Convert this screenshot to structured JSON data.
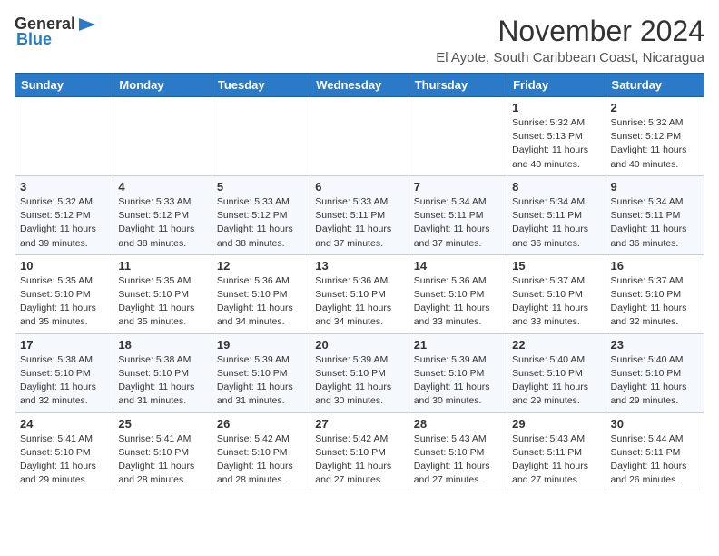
{
  "header": {
    "logo_line1": "General",
    "logo_line2": "Blue",
    "month": "November 2024",
    "location": "El Ayote, South Caribbean Coast, Nicaragua"
  },
  "days_of_week": [
    "Sunday",
    "Monday",
    "Tuesday",
    "Wednesday",
    "Thursday",
    "Friday",
    "Saturday"
  ],
  "weeks": [
    {
      "days": [
        {
          "date": "",
          "info": ""
        },
        {
          "date": "",
          "info": ""
        },
        {
          "date": "",
          "info": ""
        },
        {
          "date": "",
          "info": ""
        },
        {
          "date": "",
          "info": ""
        },
        {
          "date": "1",
          "info": "Sunrise: 5:32 AM\nSunset: 5:13 PM\nDaylight: 11 hours\nand 40 minutes."
        },
        {
          "date": "2",
          "info": "Sunrise: 5:32 AM\nSunset: 5:12 PM\nDaylight: 11 hours\nand 40 minutes."
        }
      ]
    },
    {
      "days": [
        {
          "date": "3",
          "info": "Sunrise: 5:32 AM\nSunset: 5:12 PM\nDaylight: 11 hours\nand 39 minutes."
        },
        {
          "date": "4",
          "info": "Sunrise: 5:33 AM\nSunset: 5:12 PM\nDaylight: 11 hours\nand 38 minutes."
        },
        {
          "date": "5",
          "info": "Sunrise: 5:33 AM\nSunset: 5:12 PM\nDaylight: 11 hours\nand 38 minutes."
        },
        {
          "date": "6",
          "info": "Sunrise: 5:33 AM\nSunset: 5:11 PM\nDaylight: 11 hours\nand 37 minutes."
        },
        {
          "date": "7",
          "info": "Sunrise: 5:34 AM\nSunset: 5:11 PM\nDaylight: 11 hours\nand 37 minutes."
        },
        {
          "date": "8",
          "info": "Sunrise: 5:34 AM\nSunset: 5:11 PM\nDaylight: 11 hours\nand 36 minutes."
        },
        {
          "date": "9",
          "info": "Sunrise: 5:34 AM\nSunset: 5:11 PM\nDaylight: 11 hours\nand 36 minutes."
        }
      ]
    },
    {
      "days": [
        {
          "date": "10",
          "info": "Sunrise: 5:35 AM\nSunset: 5:10 PM\nDaylight: 11 hours\nand 35 minutes."
        },
        {
          "date": "11",
          "info": "Sunrise: 5:35 AM\nSunset: 5:10 PM\nDaylight: 11 hours\nand 35 minutes."
        },
        {
          "date": "12",
          "info": "Sunrise: 5:36 AM\nSunset: 5:10 PM\nDaylight: 11 hours\nand 34 minutes."
        },
        {
          "date": "13",
          "info": "Sunrise: 5:36 AM\nSunset: 5:10 PM\nDaylight: 11 hours\nand 34 minutes."
        },
        {
          "date": "14",
          "info": "Sunrise: 5:36 AM\nSunset: 5:10 PM\nDaylight: 11 hours\nand 33 minutes."
        },
        {
          "date": "15",
          "info": "Sunrise: 5:37 AM\nSunset: 5:10 PM\nDaylight: 11 hours\nand 33 minutes."
        },
        {
          "date": "16",
          "info": "Sunrise: 5:37 AM\nSunset: 5:10 PM\nDaylight: 11 hours\nand 32 minutes."
        }
      ]
    },
    {
      "days": [
        {
          "date": "17",
          "info": "Sunrise: 5:38 AM\nSunset: 5:10 PM\nDaylight: 11 hours\nand 32 minutes."
        },
        {
          "date": "18",
          "info": "Sunrise: 5:38 AM\nSunset: 5:10 PM\nDaylight: 11 hours\nand 31 minutes."
        },
        {
          "date": "19",
          "info": "Sunrise: 5:39 AM\nSunset: 5:10 PM\nDaylight: 11 hours\nand 31 minutes."
        },
        {
          "date": "20",
          "info": "Sunrise: 5:39 AM\nSunset: 5:10 PM\nDaylight: 11 hours\nand 30 minutes."
        },
        {
          "date": "21",
          "info": "Sunrise: 5:39 AM\nSunset: 5:10 PM\nDaylight: 11 hours\nand 30 minutes."
        },
        {
          "date": "22",
          "info": "Sunrise: 5:40 AM\nSunset: 5:10 PM\nDaylight: 11 hours\nand 29 minutes."
        },
        {
          "date": "23",
          "info": "Sunrise: 5:40 AM\nSunset: 5:10 PM\nDaylight: 11 hours\nand 29 minutes."
        }
      ]
    },
    {
      "days": [
        {
          "date": "24",
          "info": "Sunrise: 5:41 AM\nSunset: 5:10 PM\nDaylight: 11 hours\nand 29 minutes."
        },
        {
          "date": "25",
          "info": "Sunrise: 5:41 AM\nSunset: 5:10 PM\nDaylight: 11 hours\nand 28 minutes."
        },
        {
          "date": "26",
          "info": "Sunrise: 5:42 AM\nSunset: 5:10 PM\nDaylight: 11 hours\nand 28 minutes."
        },
        {
          "date": "27",
          "info": "Sunrise: 5:42 AM\nSunset: 5:10 PM\nDaylight: 11 hours\nand 27 minutes."
        },
        {
          "date": "28",
          "info": "Sunrise: 5:43 AM\nSunset: 5:10 PM\nDaylight: 11 hours\nand 27 minutes."
        },
        {
          "date": "29",
          "info": "Sunrise: 5:43 AM\nSunset: 5:11 PM\nDaylight: 11 hours\nand 27 minutes."
        },
        {
          "date": "30",
          "info": "Sunrise: 5:44 AM\nSunset: 5:11 PM\nDaylight: 11 hours\nand 26 minutes."
        }
      ]
    }
  ],
  "row_classes": [
    "row-week1",
    "row-week2",
    "row-week3",
    "row-week4",
    "row-week5"
  ]
}
